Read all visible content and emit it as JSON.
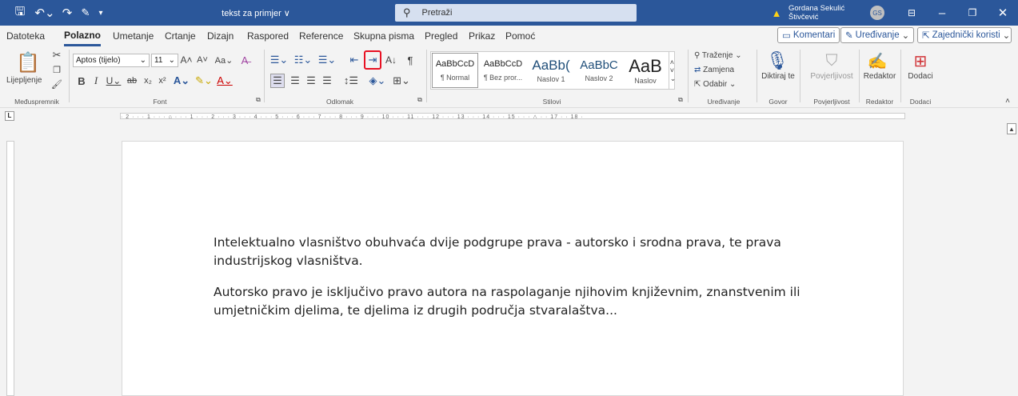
{
  "titlebar": {
    "doc_title": "tekst za primjer ∨",
    "search_placeholder": "Pretraži",
    "user_name": "Gordana Sekulić Štivčević",
    "user_initials": "GS"
  },
  "menu": {
    "tabs": [
      "Datoteka",
      "Polazno",
      "Umetanje",
      "Crtanje",
      "Dizajn",
      "Raspored",
      "Reference",
      "Skupna pisma",
      "Pregled",
      "Prikaz",
      "Pomoć"
    ],
    "active": "Polazno",
    "comments": "Komentari",
    "editing": "Uređivanje",
    "share": "Zajednički koristi"
  },
  "ribbon": {
    "paste_label": "Lijepljenje",
    "font_name": "Aptos (tijelo)",
    "font_size": "11",
    "styles": [
      {
        "preview": "AaBbCcD",
        "name": "¶ Normal"
      },
      {
        "preview": "AaBbCcD",
        "name": "¶ Bez pror..."
      },
      {
        "preview": "AaBb(",
        "name": "Naslov 1"
      },
      {
        "preview": "AaBbC",
        "name": "Naslov 2"
      },
      {
        "preview": "AaB",
        "name": "Naslov"
      }
    ],
    "find": "Traženje",
    "replace": "Zamjena",
    "select": "Odabir",
    "dictate": "Diktiraj te",
    "sensitivity": "Povjerljivost",
    "editor": "Redaktor",
    "addins": "Dodaci",
    "groups": {
      "clipboard": "Međuspremnik",
      "font": "Font",
      "paragraph": "Odlomak",
      "styles": "Stilovi",
      "editing": "Uređivanje",
      "voice": "Govor",
      "sensitivity": "Povjerljivost",
      "editor": "Redaktor",
      "addins": "Dodaci"
    }
  },
  "ruler": {
    "text": "· 2 · · · 1 · · · ⌂ · · · 1 · · · 2 · · · 3 · · · 4 · · · 5 · · · 6 · · · 7 · · · 8 · · · 9 · · · 10 · · · 11 · · · 12 · · · 13 · · · 14 · · · 15 · · · △ · · 17 · · 18 ·",
    "corner": "L"
  },
  "document": {
    "p1": "Intelektualno vlasništvo obuhvaća dvije podgrupe prava - autorsko i srodna prava, te prava industrijskog vlasništva.",
    "p2": "Autorsko pravo je isključivo pravo autora na raspolaganje njihovim književnim, znanstvenim ili umjetničkim djelima, te djelima iz drugih područja stvaralaštva..."
  },
  "colors": {
    "brand": "#2b579a",
    "highlight": "#e81123"
  }
}
